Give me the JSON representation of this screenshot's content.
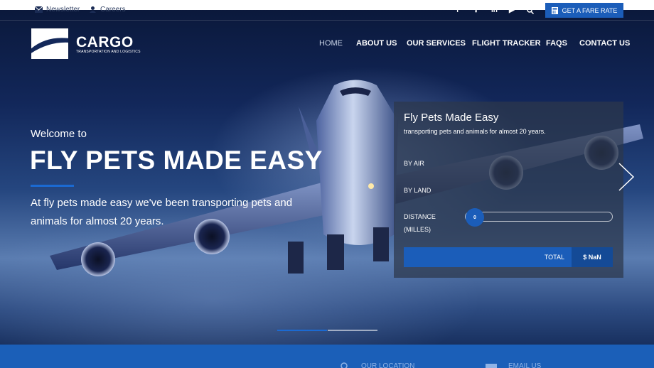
{
  "topbar": {
    "newsletter": "Newsletter",
    "careers": "Careers",
    "social_icons": [
      "facebook-icon",
      "twitter-icon",
      "linkedin-icon",
      "youtube-icon",
      "search-icon"
    ],
    "fare_button": "GET A FARE RATE"
  },
  "logo": {
    "name": "CARGO",
    "tagline": "TRANSPORTATION AND LOGISTICS"
  },
  "nav": {
    "items": [
      "HOME",
      "ABOUT US",
      "OUR SERVICES",
      "FLIGHT TRACKER",
      "FAQS",
      "CONTACT US"
    ],
    "active": "HOME"
  },
  "hero": {
    "welcome": "Welcome to",
    "headline": "FLY PETS MADE EASY",
    "lead": "At fly pets made easy we've been transporting pets and animals for almost 20 years."
  },
  "calculator": {
    "title": "Fly Pets Made Easy",
    "subtitle": "transporting pets and animals for almost 20 years.",
    "by_air": "BY AIR",
    "by_land": "BY LAND",
    "distance_label_1": "DISTANCE",
    "distance_label_2": "(MILLES)",
    "slider_value": "0",
    "total_label": "TOTAL",
    "total_value": "$ NaN"
  },
  "slider_dots": 2,
  "bottom": {
    "location": "OUR LOCATION",
    "email": "EMAIL US"
  },
  "colors": {
    "accent": "#1b5db9",
    "accent_dark": "#144a96"
  }
}
